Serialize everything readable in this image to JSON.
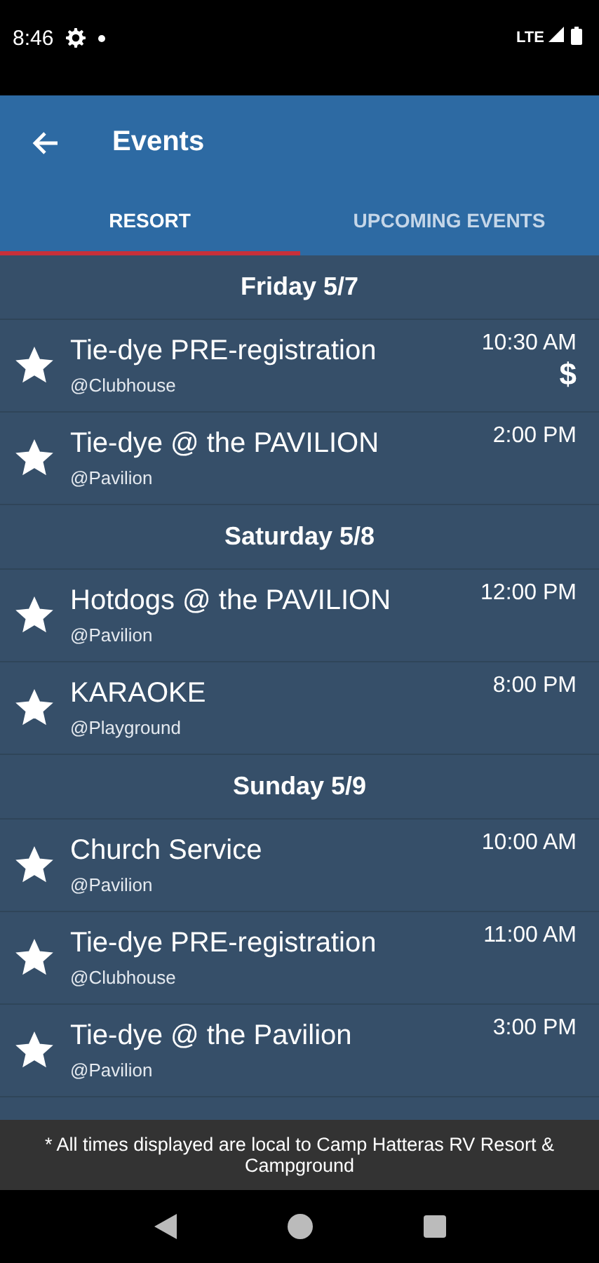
{
  "status_bar": {
    "time": "8:46",
    "network": "LTE"
  },
  "app_bar": {
    "title": "Events"
  },
  "tabs": [
    {
      "label": "RESORT",
      "selected": true
    },
    {
      "label": "UPCOMING EVENTS",
      "selected": false
    }
  ],
  "days": [
    {
      "date": "Friday 5/7",
      "events": [
        {
          "title": "Tie-dye PRE-registration",
          "location": "@Clubhouse",
          "time": "10:30 AM",
          "price": "$",
          "starred": true
        },
        {
          "title": "Tie-dye @ the PAVILION",
          "location": "@Pavilion",
          "time": "2:00 PM",
          "starred": true
        }
      ]
    },
    {
      "date": "Saturday 5/8",
      "events": [
        {
          "title": "Hotdogs @ the PAVILION",
          "location": "@Pavilion",
          "time": "12:00 PM",
          "starred": true
        },
        {
          "title": "KARAOKE",
          "location": "@Playground",
          "time": "8:00 PM",
          "starred": true
        }
      ]
    },
    {
      "date": "Sunday 5/9",
      "events": [
        {
          "title": "Church Service",
          "location": "@Pavilion",
          "time": "10:00 AM",
          "starred": true
        },
        {
          "title": "Tie-dye PRE-registration",
          "location": "@Clubhouse",
          "time": "11:00 AM",
          "starred": true
        },
        {
          "title": "Tie-dye @ the Pavilion",
          "location": "@Pavilion",
          "time": "3:00 PM",
          "starred": true
        }
      ]
    }
  ],
  "footer": "* All times displayed are local to Camp Hatteras RV Resort & Campground"
}
